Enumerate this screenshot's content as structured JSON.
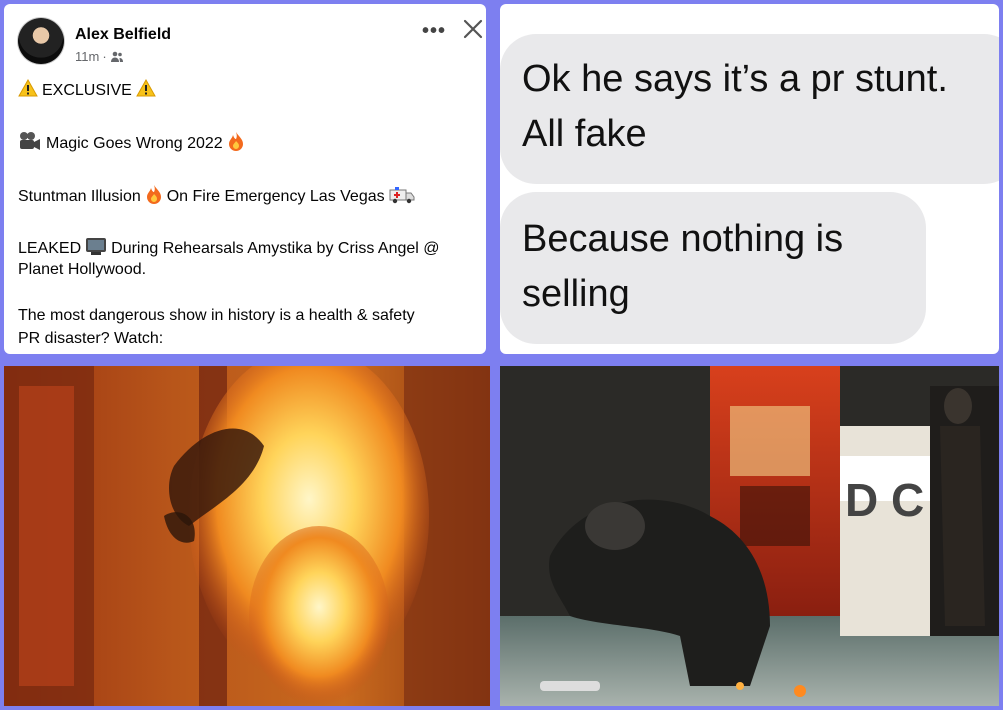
{
  "post": {
    "author": "Alex Belfield",
    "time": "11m",
    "exclusive": "EXCLUSIVE",
    "title": "Magic Goes Wrong 2022",
    "line2": "Stuntman Illusion",
    "line2b": "On Fire Emergency Las Vegas",
    "leaked_a": "LEAKED",
    "leaked_b": "During Rehearsals Amystika by Criss Angel @",
    "leaked_c": "Planet Hollywood.",
    "body_a": "The most dangerous show in history is a health & safety",
    "body_b": "PR disaster? Watch:",
    "icons": [
      "warning-icon",
      "video-camera-icon",
      "fire-icon",
      "ambulance-icon",
      "tv-icon",
      "friends-icon",
      "more-icon",
      "close-icon"
    ]
  },
  "chat": {
    "message_1a": "Ok he says it’s a pr stunt.",
    "message_1b": "All fake",
    "message_2a": "Because nothing is",
    "message_2b": "selling"
  },
  "photos": {
    "sign_letters": "D C"
  },
  "colors": {
    "frame": "#7d7ff0",
    "bubble": "#e9e9eb",
    "meta_text": "#65676b"
  }
}
